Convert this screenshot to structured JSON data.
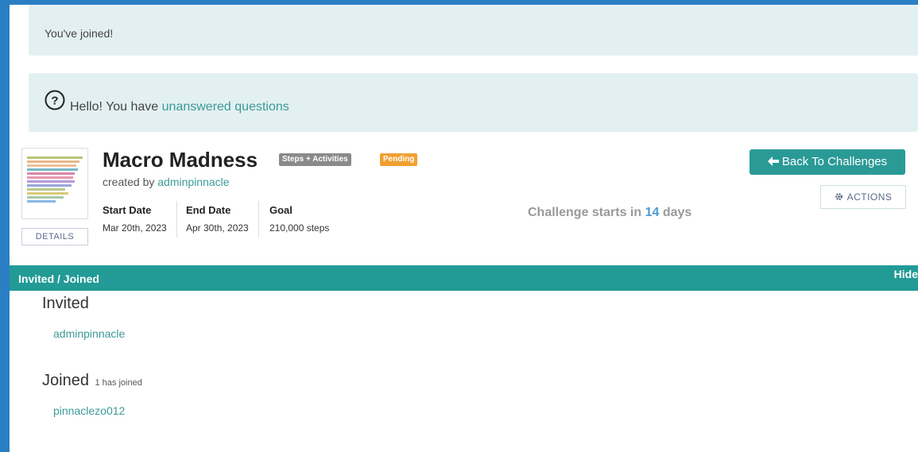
{
  "alerts": {
    "joined": "You've joined!",
    "questions_prefix": "Hello! You have ",
    "questions_link": "unanswered questions"
  },
  "challenge": {
    "title": "Macro Madness",
    "type_badge": "Steps + Activities",
    "status_badge": "Pending",
    "created_by_label": "created by ",
    "creator": "adminpinnacle",
    "details_button": "DETAILS",
    "stats": {
      "start_label": "Start Date",
      "start_value": "Mar 20th, 2023",
      "end_label": "End Date",
      "end_value": "Apr 30th, 2023",
      "goal_label": "Goal",
      "goal_value": "210,000 steps"
    },
    "starts_in_prefix": "Challenge starts in ",
    "starts_in_days": "14",
    "starts_in_suffix": " days"
  },
  "buttons": {
    "back": "Back To Challenges",
    "actions": "ACTIONS"
  },
  "section": {
    "title": "Invited / Joined",
    "hide": "Hide",
    "invited_heading": "Invited",
    "invited_users": [
      "adminpinnacle"
    ],
    "joined_heading": "Joined",
    "joined_count": "1 has joined",
    "joined_users": [
      "pinnaclezo012"
    ]
  },
  "colors": {
    "accent": "#229a96",
    "link": "#3a9a97",
    "pending": "#f0a030",
    "days": "#4a9ad4"
  },
  "icons": {
    "question": "question-circle-icon",
    "arrow": "arrow-left-icon",
    "gear": "gear-icon"
  }
}
